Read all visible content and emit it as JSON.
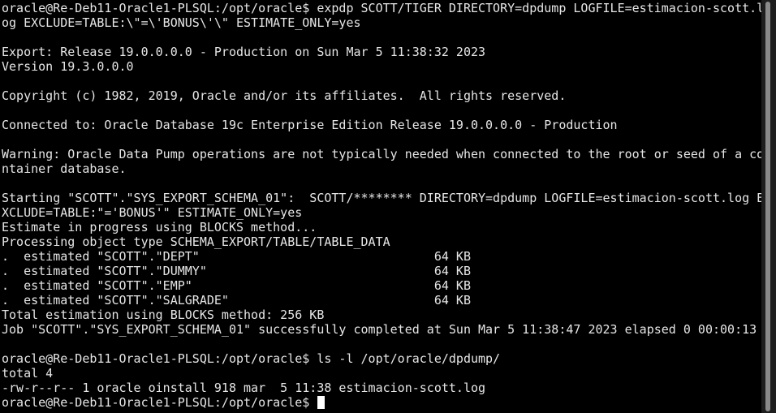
{
  "terminal": {
    "lines": [
      "oracle@Re-Deb11-Oracle1-PLSQL:/opt/oracle$ expdp SCOTT/TIGER DIRECTORY=dpdump LOGFILE=estimacion-scott.l",
      "og EXCLUDE=TABLE:\\\"=\\'BONUS\\'\\\" ESTIMATE_ONLY=yes",
      "",
      "Export: Release 19.0.0.0.0 - Production on Sun Mar 5 11:38:32 2023",
      "Version 19.3.0.0.0",
      "",
      "Copyright (c) 1982, 2019, Oracle and/or its affiliates.  All rights reserved.",
      "",
      "Connected to: Oracle Database 19c Enterprise Edition Release 19.0.0.0.0 - Production",
      "",
      "Warning: Oracle Data Pump operations are not typically needed when connected to the root or seed of a co",
      "ntainer database.",
      "",
      "Starting \"SCOTT\".\"SYS_EXPORT_SCHEMA_01\":  SCOTT/******** DIRECTORY=dpdump LOGFILE=estimacion-scott.log E",
      "XCLUDE=TABLE:\"='BONUS'\" ESTIMATE_ONLY=yes",
      "Estimate in progress using BLOCKS method...",
      "Processing object type SCHEMA_EXPORT/TABLE/TABLE_DATA",
      ".  estimated \"SCOTT\".\"DEPT\"                                64 KB",
      ".  estimated \"SCOTT\".\"DUMMY\"                               64 KB",
      ".  estimated \"SCOTT\".\"EMP\"                                 64 KB",
      ".  estimated \"SCOTT\".\"SALGRADE\"                            64 KB",
      "Total estimation using BLOCKS method: 256 KB",
      "Job \"SCOTT\".\"SYS_EXPORT_SCHEMA_01\" successfully completed at Sun Mar 5 11:38:47 2023 elapsed 0 00:00:13",
      "",
      "oracle@Re-Deb11-Oracle1-PLSQL:/opt/oracle$ ls -l /opt/oracle/dpdump/",
      "total 4",
      "-rw-r--r-- 1 oracle oinstall 918 mar  5 11:38 estimacion-scott.log"
    ],
    "prompt": "oracle@Re-Deb11-Oracle1-PLSQL:/opt/oracle$ ",
    "colors": {
      "background": "#000000",
      "foreground": "#e6e6e6",
      "cursor": "#ffffff",
      "scrollbar_track": "#1e1e1e",
      "scrollbar_thumb": "#8a8a8a"
    }
  }
}
